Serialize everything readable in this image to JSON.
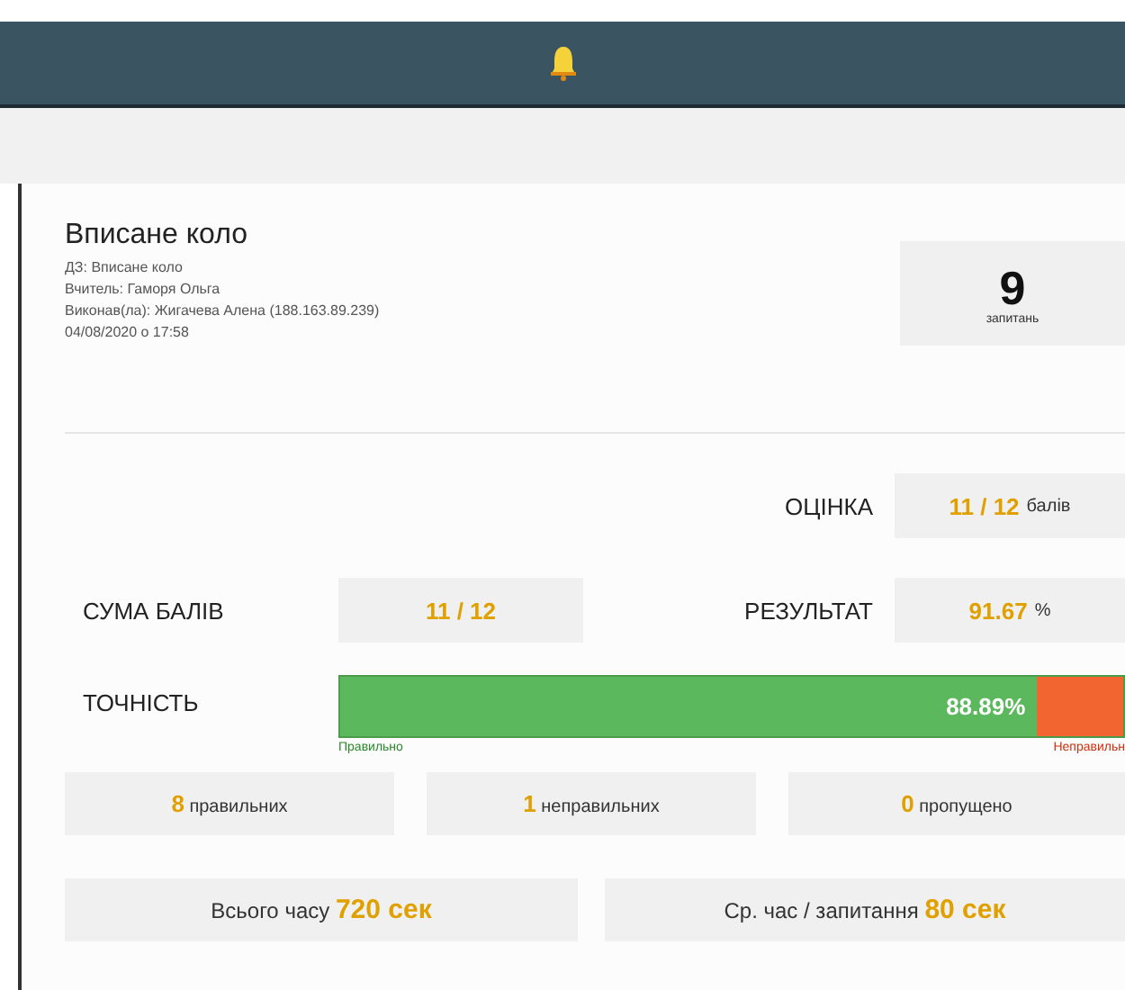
{
  "test": {
    "title": "Вписане коло",
    "lines": [
      "ДЗ: Вписане коло",
      "Вчитель: Гаморя Ольга",
      "Виконав(ла): Жигачева Алена (188.163.89.239)",
      "04/08/2020 о 17:58"
    ]
  },
  "questions": {
    "value": "9",
    "label": "запитань"
  },
  "grade": {
    "label": "ОЦІНКА",
    "value": "11 / 12",
    "unit": "балів"
  },
  "sum": {
    "label": "СУМА БАЛІВ",
    "value": "11 / 12"
  },
  "result": {
    "label": "РЕЗУЛЬТАТ",
    "value": "91.67",
    "unit": "%"
  },
  "accuracy": {
    "label": "ТОЧНІСТЬ",
    "level": 0.8889,
    "reading": "88.89%",
    "correct_label": "Правильно",
    "wrong_label": "Неправильн"
  },
  "counts": [
    {
      "value": "8",
      "label": "правильних"
    },
    {
      "value": "1",
      "label": "неправильних"
    },
    {
      "value": "0",
      "label": "пропущено"
    }
  ],
  "times": [
    {
      "label": "Всього часу",
      "value": "720 сек"
    },
    {
      "label": "Ср. час / запитання",
      "value": "80 сек"
    }
  ]
}
